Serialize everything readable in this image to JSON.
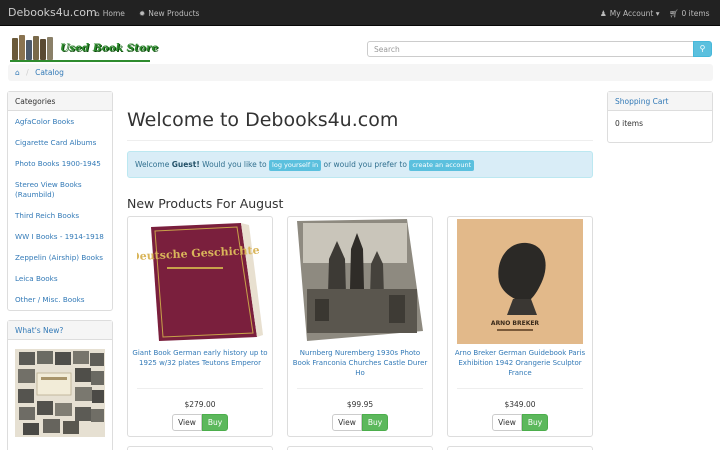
{
  "navbar": {
    "brand": "Debooks4u.com",
    "home_label": "Home",
    "new_products_label": "New Products",
    "account_label": "My Account",
    "cart_label": "0 items"
  },
  "header": {
    "logo_text": "Used Book Store",
    "search": {
      "placeholder": "Search"
    }
  },
  "breadcrumb": {
    "current": "Catalog"
  },
  "sidebar": {
    "categories_title": "Categories",
    "categories": [
      "AgfaColor Books",
      "Cigarette Card Albums",
      "Photo Books 1900-1945",
      "Stereo View Books (Raumbild)",
      "Third Reich Books",
      "WW I Books - 1914-1918",
      "Zeppelin (Airship) Books",
      "Leica Books",
      "Other / Misc. Books"
    ],
    "whats_new_title": "What's New?"
  },
  "cart": {
    "title": "Shopping Cart",
    "content": "0 items"
  },
  "main": {
    "welcome_title": "Welcome to Debooks4u.com",
    "alert": {
      "welcome": "Welcome",
      "guest": "Guest!",
      "would_you": "Would you like to",
      "login": "log yourself in",
      "or_prefer": "or would you prefer to",
      "create": "create an account"
    },
    "section_title": "New Products For August",
    "products": [
      {
        "title": "Giant Book German early history up to 1925 w/32 plates Teutons Emperor",
        "price": "$279.00",
        "view_label": "View",
        "buy_label": "Buy",
        "cover_text": "Deutsche Geschichte"
      },
      {
        "title": "Nurnberg Nuremberg 1930s Photo Book Franconia Churches Castle Durer Ho",
        "price": "$99.95",
        "view_label": "View",
        "buy_label": "Buy",
        "cover_text": ""
      },
      {
        "title": "Arno Breker German Guidebook Paris Exhibition 1942 Orangerie Sculptor France",
        "price": "$349.00",
        "view_label": "View",
        "buy_label": "Buy",
        "cover_text": "ARNO BREKER"
      }
    ]
  },
  "colors": {
    "navbar_bg": "#222222",
    "link": "#337ab7",
    "buy_green": "#5cb85c",
    "info_blue": "#5bc0de",
    "logo_green": "#2e8b2e"
  }
}
